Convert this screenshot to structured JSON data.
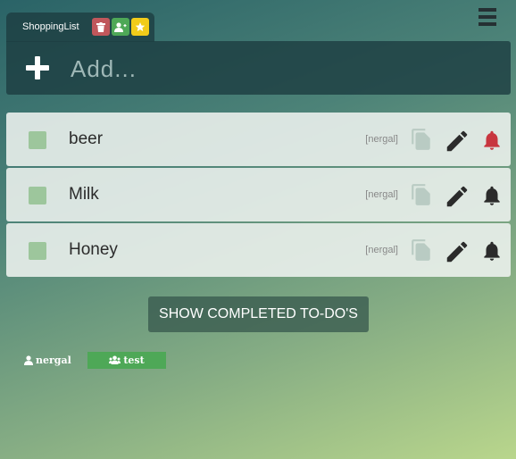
{
  "list": {
    "tab_title": "ShoppingList",
    "tab_buttons": [
      {
        "icon": "trash-icon",
        "color": "#c0575b"
      },
      {
        "icon": "add-user-icon",
        "color": "#4ea857"
      },
      {
        "icon": "star-icon",
        "color": "#f2cc1a"
      }
    ]
  },
  "add": {
    "placeholder": "Add..."
  },
  "items": [
    {
      "label": "beer",
      "owner": "[nergal]",
      "bell_active": true
    },
    {
      "label": "Milk",
      "owner": "[nergal]",
      "bell_active": false
    },
    {
      "label": "Honey",
      "owner": "[nergal]",
      "bell_active": false
    }
  ],
  "show_completed_label": "SHOW COMPLETED TO-DO'S",
  "users": [
    {
      "name": "nergal",
      "icon": "user-icon"
    },
    {
      "name": "test",
      "icon": "group-icon",
      "color": "#4ea857"
    }
  ],
  "colors": {
    "bell_active": "#c8363f",
    "bell": "#2b2b2b",
    "check": "#9dc69c"
  }
}
